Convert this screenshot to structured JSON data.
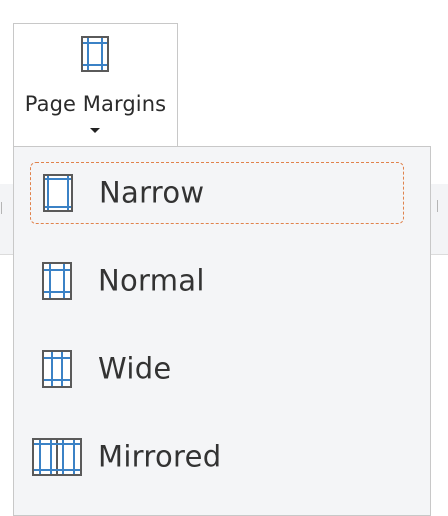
{
  "button": {
    "label": "Page Margins",
    "icon": "page-margins-icon"
  },
  "menu": {
    "items": [
      {
        "label": "Narrow",
        "icon": "narrow-margins-icon",
        "selected": true
      },
      {
        "label": "Normal",
        "icon": "normal-margins-icon",
        "selected": false
      },
      {
        "label": "Wide",
        "icon": "wide-margins-icon",
        "selected": false
      },
      {
        "label": "Mirrored",
        "icon": "mirrored-margins-icon",
        "selected": false
      }
    ]
  },
  "colors": {
    "selection_border": "#e0824c",
    "icon_blue": "#3b82c6",
    "icon_frame": "#5a5a5a",
    "menu_background": "#f4f5f7"
  }
}
